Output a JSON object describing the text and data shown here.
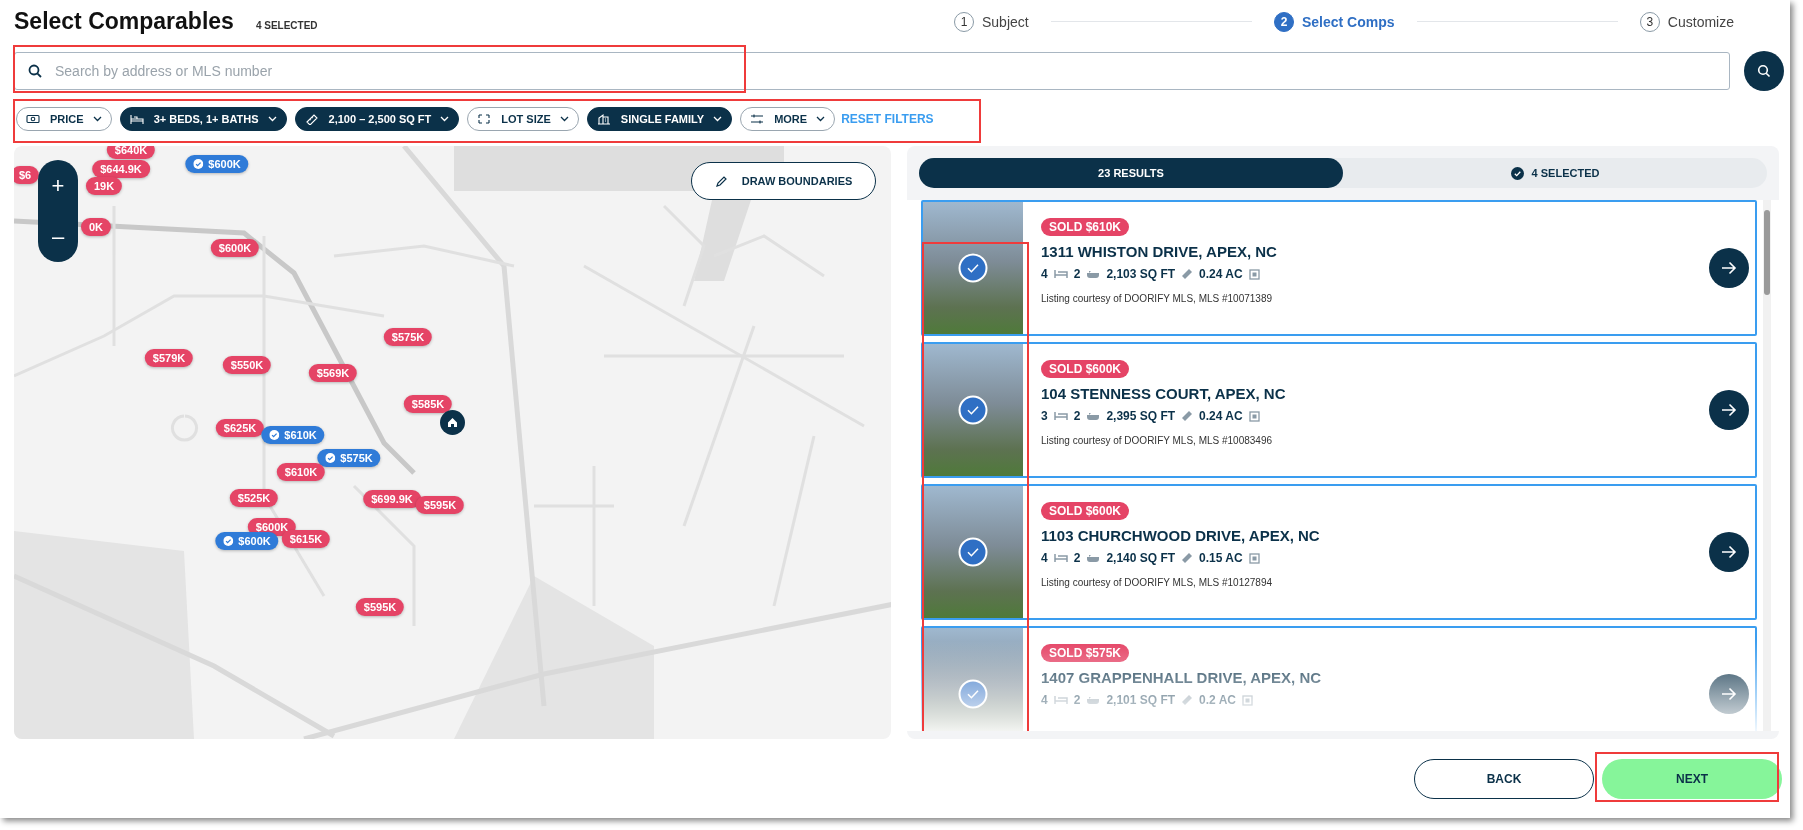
{
  "header": {
    "title": "Select Comparables",
    "selected_count": "4 SELECTED"
  },
  "steps": [
    {
      "number": "1",
      "label": "Subject",
      "selected": false
    },
    {
      "number": "2",
      "label": "Select Comps",
      "selected": true
    },
    {
      "number": "3",
      "label": "Customize",
      "selected": false
    }
  ],
  "search": {
    "placeholder": "Search by address or MLS number",
    "highlighted": true
  },
  "filters": {
    "highlighted": true,
    "items": [
      {
        "label": "PRICE",
        "active": false
      },
      {
        "label": "3+ BEDS, 1+ BATHS",
        "active": true
      },
      {
        "label": "2,100 – 2,500 SQ FT",
        "active": true
      },
      {
        "label": "LOT SIZE",
        "active": false
      },
      {
        "label": "SINGLE FAMILY",
        "active": true
      },
      {
        "label": "MORE",
        "active": false
      }
    ],
    "reset": "RESET FILTERS"
  },
  "map": {
    "draw_button": "DRAW BOUNDARIES",
    "zoom_in": "+",
    "zoom_out": "–",
    "pins": [
      {
        "price": "$640K",
        "selected": false
      },
      {
        "price": "$644.9K",
        "selected": false
      },
      {
        "price": "$6",
        "selected": false
      },
      {
        "price": "19K",
        "selected": false
      },
      {
        "price": "0K",
        "selected": false
      },
      {
        "price": "$600K",
        "selected": true
      },
      {
        "price": "$600K",
        "selected": false
      },
      {
        "price": "$575K",
        "selected": false
      },
      {
        "price": "$579K",
        "selected": false
      },
      {
        "price": "$550K",
        "selected": false
      },
      {
        "price": "$569K",
        "selected": false
      },
      {
        "price": "$585K",
        "selected": false
      },
      {
        "price": "$625K",
        "selected": false
      },
      {
        "price": "$610K",
        "selected": true
      },
      {
        "price": "$575K",
        "selected": true
      },
      {
        "price": "$610K",
        "selected": false
      },
      {
        "price": "$525K",
        "selected": false
      },
      {
        "price": "$699.9K",
        "selected": false
      },
      {
        "price": "$595K",
        "selected": false
      },
      {
        "price": "$600K",
        "selected": false
      },
      {
        "price": "$600K",
        "selected": true
      },
      {
        "price": "$615K",
        "selected": false
      },
      {
        "price": "$595K",
        "selected": false
      }
    ]
  },
  "results": {
    "tabs": [
      {
        "label": "23 RESULTS",
        "selected": true
      },
      {
        "label": "4 SELECTED",
        "selected": false
      }
    ],
    "photos_highlighted": true,
    "listings": [
      {
        "sold": "SOLD $610K",
        "address": "1311 WHISTON DRIVE, APEX, NC",
        "beds": "4",
        "baths": "2",
        "sqft": "2,103 SQ FT",
        "lot": "0.24 AC",
        "courtesy": "Listing courtesy of DOORIFY MLS, MLS #10071389",
        "selected": true
      },
      {
        "sold": "SOLD $600K",
        "address": "104 STENNESS COURT, APEX, NC",
        "beds": "3",
        "baths": "2",
        "sqft": "2,395 SQ FT",
        "lot": "0.24 AC",
        "courtesy": "Listing courtesy of DOORIFY MLS, MLS #10083496",
        "selected": true
      },
      {
        "sold": "SOLD $600K",
        "address": "1103 CHURCHWOOD DRIVE, APEX, NC",
        "beds": "4",
        "baths": "2",
        "sqft": "2,140 SQ FT",
        "lot": "0.15 AC",
        "courtesy": "Listing courtesy of DOORIFY MLS, MLS #10127894",
        "selected": true
      },
      {
        "sold": "SOLD $575K",
        "address": "1407 GRAPPENHALL DRIVE, APEX, NC",
        "beds": "4",
        "baths": "2",
        "sqft": "2,101 SQ FT",
        "lot": "0.2 AC",
        "selected": true
      }
    ]
  },
  "footer": {
    "back": "BACK",
    "next": "NEXT",
    "next_highlighted": true
  }
}
